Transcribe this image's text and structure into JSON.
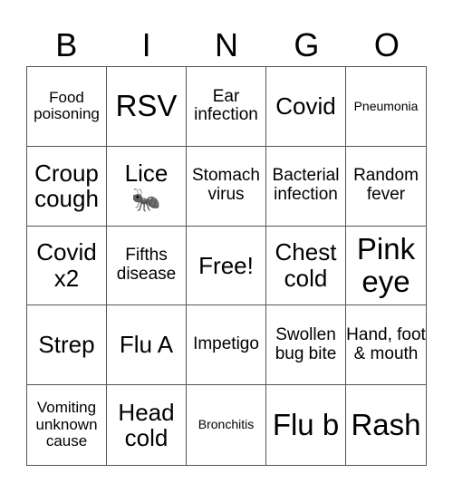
{
  "header": [
    "B",
    "I",
    "N",
    "G",
    "O"
  ],
  "cells": [
    {
      "text": "Food poisoning",
      "size": "s"
    },
    {
      "text": "RSV",
      "size": "xl"
    },
    {
      "text": "Ear infection",
      "size": "m"
    },
    {
      "text": "Covid",
      "size": "l"
    },
    {
      "text": "Pneumonia",
      "size": "xs"
    },
    {
      "text": "Croup cough",
      "size": "l"
    },
    {
      "text": "Lice",
      "size": "l",
      "icon": "🐜",
      "icon_name": "ant-icon"
    },
    {
      "text": "Stomach virus",
      "size": "m"
    },
    {
      "text": "Bacterial infection",
      "size": "m"
    },
    {
      "text": "Random fever",
      "size": "m"
    },
    {
      "text": "Covid x2",
      "size": "l"
    },
    {
      "text": "Fifths disease",
      "size": "m"
    },
    {
      "text": "Free!",
      "size": "l"
    },
    {
      "text": "Chest cold",
      "size": "l"
    },
    {
      "text": "Pink eye",
      "size": "xl"
    },
    {
      "text": "Strep",
      "size": "l"
    },
    {
      "text": "Flu A",
      "size": "l"
    },
    {
      "text": "Impetigo",
      "size": "m"
    },
    {
      "text": "Swollen bug bite",
      "size": "m"
    },
    {
      "text": "Hand, foot & mouth",
      "size": "m"
    },
    {
      "text": "Vomiting unknown cause",
      "size": "s"
    },
    {
      "text": "Head cold",
      "size": "l"
    },
    {
      "text": "Bronchitis",
      "size": "xs"
    },
    {
      "text": "Flu b",
      "size": "xl"
    },
    {
      "text": "Rash",
      "size": "xl"
    }
  ]
}
